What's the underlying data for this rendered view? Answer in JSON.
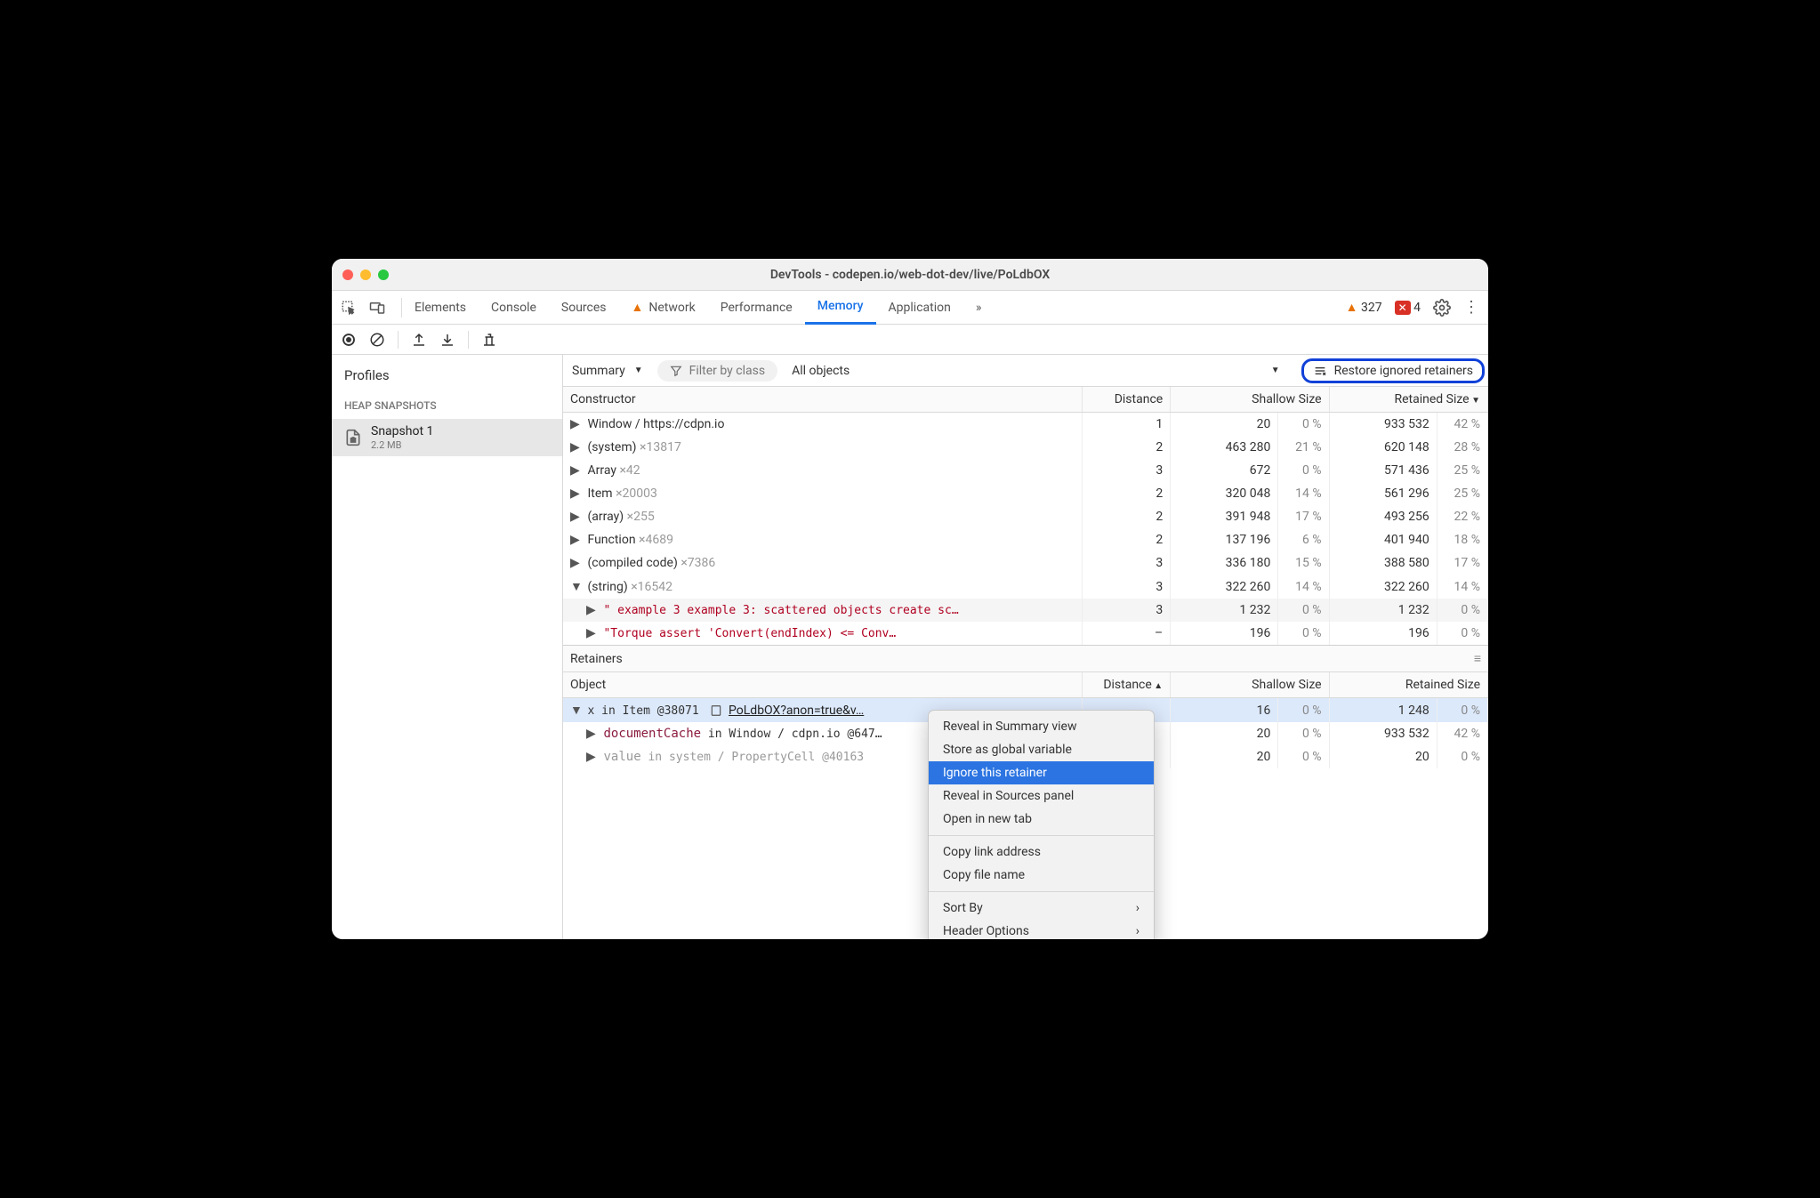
{
  "title": "DevTools - codepen.io/web-dot-dev/live/PoLdbOX",
  "tabs": [
    "Elements",
    "Console",
    "Sources",
    "Network",
    "Performance",
    "Memory",
    "Application"
  ],
  "active_tab": "Memory",
  "warnings_count": "327",
  "errors_count": "4",
  "sidebar": {
    "profiles_label": "Profiles",
    "section_label": "HEAP SNAPSHOTS",
    "snapshot": {
      "name": "Snapshot 1",
      "size": "2.2 MB"
    }
  },
  "main_toolbar": {
    "view": "Summary",
    "filter_placeholder": "Filter by class",
    "scope": "All objects",
    "restore_label": "Restore ignored retainers"
  },
  "columns": {
    "constructor": "Constructor",
    "object": "Object",
    "distance": "Distance",
    "shallow": "Shallow Size",
    "retained": "Retained Size"
  },
  "rows": [
    {
      "name": "Window / https://cdpn.io",
      "count": "",
      "distance": "1",
      "shallow": "20",
      "shallow_pct": "0 %",
      "retained": "933 532",
      "retained_pct": "42 %",
      "indent": 0
    },
    {
      "name": "(system)",
      "count": "×13817",
      "distance": "2",
      "shallow": "463 280",
      "shallow_pct": "21 %",
      "retained": "620 148",
      "retained_pct": "28 %",
      "indent": 0
    },
    {
      "name": "Array",
      "count": "×42",
      "distance": "3",
      "shallow": "672",
      "shallow_pct": "0 %",
      "retained": "571 436",
      "retained_pct": "25 %",
      "indent": 0
    },
    {
      "name": "Item",
      "count": "×20003",
      "distance": "2",
      "shallow": "320 048",
      "shallow_pct": "14 %",
      "retained": "561 296",
      "retained_pct": "25 %",
      "indent": 0
    },
    {
      "name": "(array)",
      "count": "×255",
      "distance": "2",
      "shallow": "391 948",
      "shallow_pct": "17 %",
      "retained": "493 256",
      "retained_pct": "22 %",
      "indent": 0
    },
    {
      "name": "Function",
      "count": "×4689",
      "distance": "2",
      "shallow": "137 196",
      "shallow_pct": "6 %",
      "retained": "401 940",
      "retained_pct": "18 %",
      "indent": 0
    },
    {
      "name": "(compiled code)",
      "count": "×7386",
      "distance": "3",
      "shallow": "336 180",
      "shallow_pct": "15 %",
      "retained": "388 580",
      "retained_pct": "17 %",
      "indent": 0
    },
    {
      "name": "(string)",
      "count": "×16542",
      "distance": "3",
      "shallow": "322 260",
      "shallow_pct": "14 %",
      "retained": "322 260",
      "retained_pct": "14 %",
      "indent": 0,
      "expanded": true
    }
  ],
  "child_rows": [
    {
      "text": "\" example 3 example 3: scattered objects create sc…",
      "distance": "3",
      "shallow": "1 232",
      "shallow_pct": "0 %",
      "retained": "1 232",
      "retained_pct": "0 %",
      "alt": true
    },
    {
      "text": "\"Torque assert 'Convert<uintptr>(endIndex) <= Conv…",
      "distance": "–",
      "shallow": "196",
      "shallow_pct": "0 %",
      "retained": "196",
      "retained_pct": "0 %",
      "alt": false
    }
  ],
  "retainers_label": "Retainers",
  "retainer_rows": [
    {
      "prop": "x",
      "prop_class": "mono",
      "in": " in Item @38071 ",
      "link": "PoLdbOX?anon=true&v…",
      "distance": "",
      "shallow": "16",
      "shallow_pct": "0 %",
      "retained": "1 248",
      "retained_pct": "0 %",
      "expanded": true,
      "selected": true,
      "has_icon": true
    },
    {
      "prop": "documentCache",
      "prop_class": "prop-name-red",
      "in": " in Window / cdpn.io @647…",
      "link": "",
      "distance": "",
      "shallow": "20",
      "shallow_pct": "0 %",
      "retained": "933 532",
      "retained_pct": "42 %",
      "expanded": false,
      "selected": false
    },
    {
      "prop": "value",
      "prop_class": "prop-name-grey",
      "in": " in system / PropertyCell @40163",
      "link": "",
      "distance": "",
      "shallow": "20",
      "shallow_pct": "0 %",
      "retained": "20",
      "retained_pct": "0 %",
      "expanded": false,
      "selected": false,
      "greyed": true
    }
  ],
  "context_menu": {
    "items1": [
      "Reveal in Summary view",
      "Store as global variable",
      "Ignore this retainer",
      "Reveal in Sources panel",
      "Open in new tab"
    ],
    "items2": [
      "Copy link address",
      "Copy file name"
    ],
    "items3": [
      "Sort By",
      "Header Options"
    ],
    "highlighted": "Ignore this retainer"
  }
}
